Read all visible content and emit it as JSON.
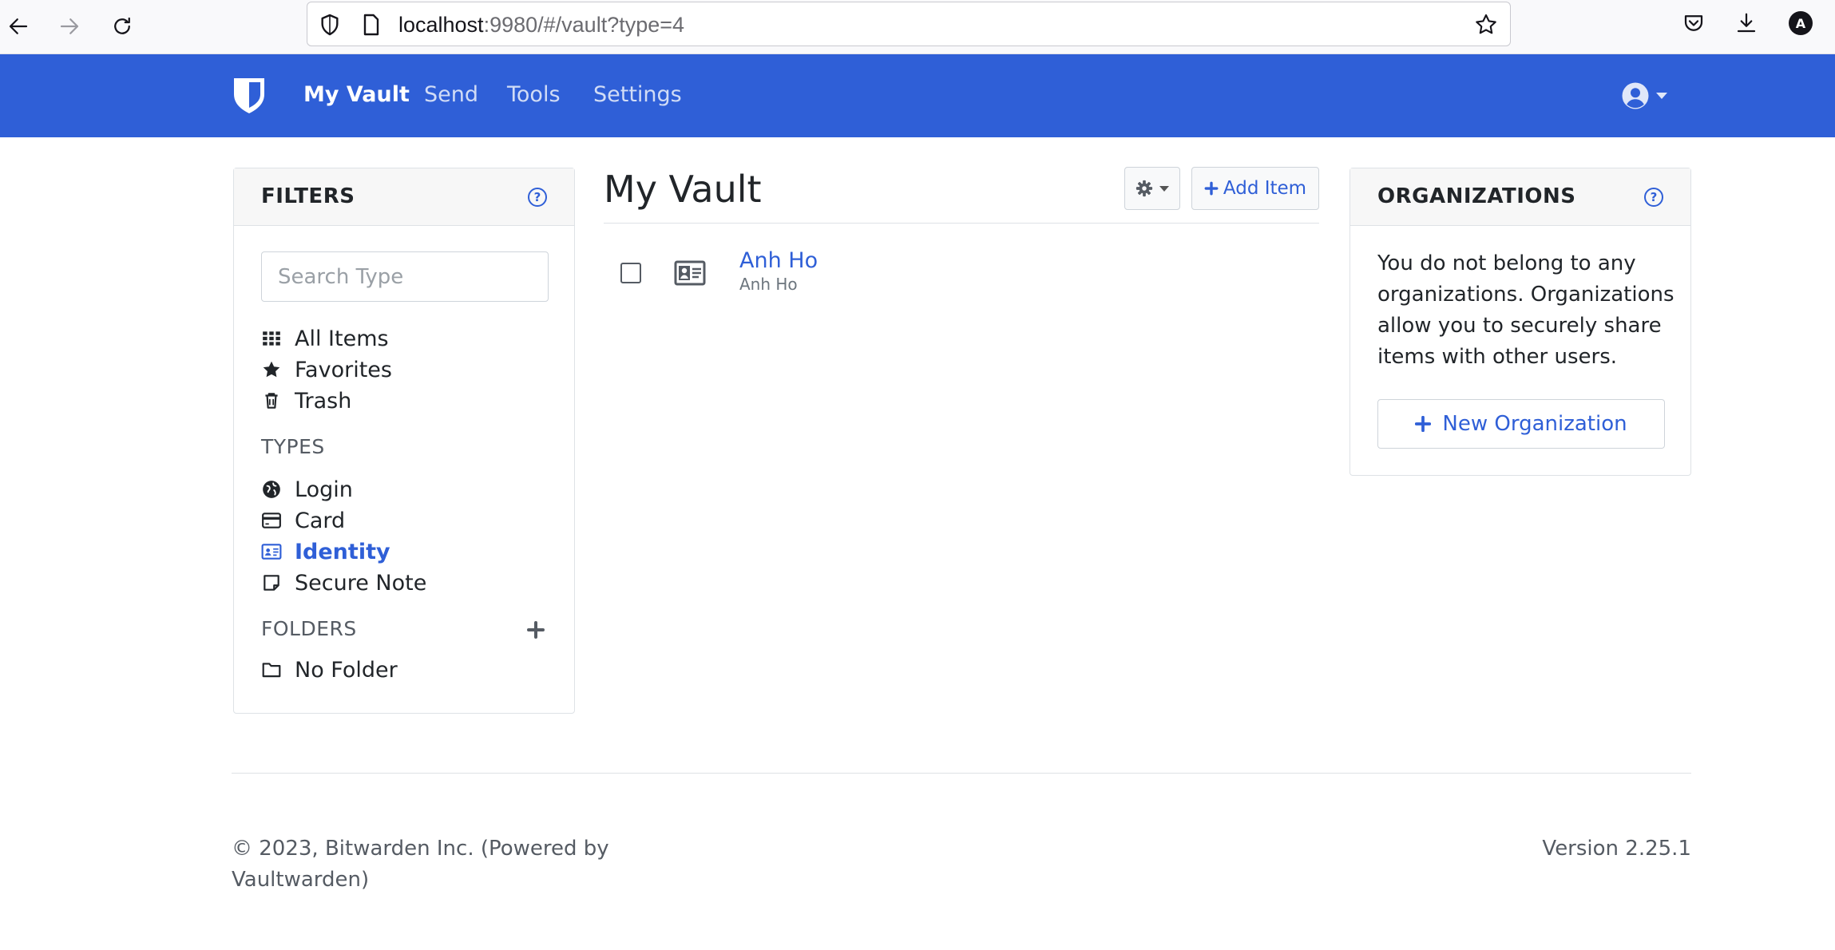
{
  "browser": {
    "url_host": "localhost",
    "url_rest": ":9980/#/vault?type=4",
    "account_initial": "A"
  },
  "navbar": {
    "links": [
      {
        "label": "My Vault",
        "active": true
      },
      {
        "label": "Send",
        "active": false
      },
      {
        "label": "Tools",
        "active": false
      },
      {
        "label": "Settings",
        "active": false
      }
    ]
  },
  "filters": {
    "title": "FILTERS",
    "search_placeholder": "Search Type",
    "items": [
      {
        "label": "All Items",
        "icon": "grid-icon"
      },
      {
        "label": "Favorites",
        "icon": "star-icon"
      },
      {
        "label": "Trash",
        "icon": "trash-icon"
      }
    ],
    "types_label": "TYPES",
    "types": [
      {
        "label": "Login",
        "icon": "globe-icon",
        "active": false
      },
      {
        "label": "Card",
        "icon": "credit-card-icon",
        "active": false
      },
      {
        "label": "Identity",
        "icon": "id-card-icon",
        "active": true
      },
      {
        "label": "Secure Note",
        "icon": "note-icon",
        "active": false
      }
    ],
    "folders_label": "FOLDERS",
    "folders": [
      {
        "label": "No Folder",
        "icon": "folder-icon"
      }
    ]
  },
  "vault": {
    "title": "My Vault",
    "add_item_label": "Add Item",
    "items": [
      {
        "name": "Anh Ho",
        "subtitle": "Anh Ho",
        "icon": "id-card-icon"
      }
    ]
  },
  "organizations": {
    "title": "ORGANIZATIONS",
    "description": "You do not belong to any organizations. Organizations allow you to securely share items with other users.",
    "new_org_label": "New Organization"
  },
  "footer": {
    "copyright": "© 2023, Bitwarden Inc. (Powered by Vaultwarden)",
    "version": "Version 2.25.1"
  },
  "colors": {
    "brand": "#2f5fd7",
    "link": "#2f5fd7",
    "muted": "#6c757d"
  }
}
